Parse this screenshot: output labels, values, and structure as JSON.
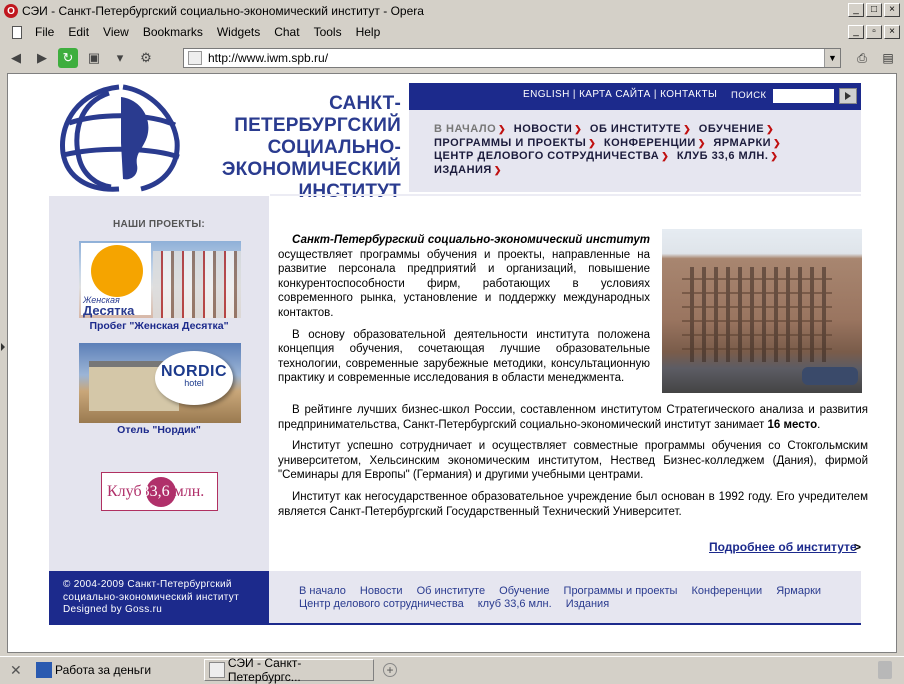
{
  "window": {
    "title": "СЭИ - Санкт-Петербургский социально-экономический институт - Opera"
  },
  "menu": [
    "File",
    "Edit",
    "View",
    "Bookmarks",
    "Widgets",
    "Chat",
    "Tools",
    "Help"
  ],
  "address": {
    "url": "http://www.iwm.spb.ru/"
  },
  "site": {
    "logo_lines": [
      "САНКТ-ПЕТЕРБУРГСКИЙ",
      "СОЦИАЛЬНО-",
      "ЭКОНОМИЧЕСКИЙ",
      "ИНСТИТУТ"
    ],
    "top_links": [
      "ENGLISH",
      "КАРТА САЙТА",
      "КОНТАКТЫ"
    ],
    "search_label": "ПОИСК",
    "nav": [
      "В НАЧАЛО",
      "НОВОСТИ",
      "ОБ ИНСТИТУТЕ",
      "ОБУЧЕНИЕ",
      "ПРОГРАММЫ И ПРОЕКТЫ",
      "КОНФЕРЕНЦИИ",
      "ЯРМАРКИ",
      "ЦЕНТР ДЕЛОВОГО СОТРУДНИЧЕСТВА",
      "КЛУБ 33,6 МЛН.",
      "ИЗДАНИЯ"
    ],
    "sidebar": {
      "title": "НАШИ ПРОЕКТЫ:",
      "project1_logo_small": "Женская",
      "project1_logo_big": "Десятка",
      "project1_caption": "Пробег \"Женская Десятка\"",
      "project2_logo": "NORDIC",
      "project2_logo_sub": "hotel",
      "project2_caption": "Отель \"Нордик\"",
      "club_a": "Клуб",
      "club_b": "33,6",
      "club_c": " млн."
    },
    "content": {
      "intro_bold": "Санкт-Петербургский социально-экономический институт",
      "intro_rest": " осуществляет программы обучения и проекты, направленные на развитие персонала предприятий и организаций, повышение конкурентоспособности фирм, работающих в условиях современного рынка, установление и поддержку международных контактов.",
      "p2": "В основу образовательной деятельности института положена концепция обучения, сочетающая лучшие образовательные технологии, современные зарубежные методики, консультационную практику и современные исследования в области менеджмента.",
      "p3_a": "В рейтинге лучших бизнес-школ России, составленном институтом Стратегического анализа и развития предпринимательства, Санкт-Петербургский социально-экономический институт занимает ",
      "p3_bold": "16 место",
      "p3_end": ".",
      "p4": "Институт успешно сотрудничает и осуществляет совместные программы обучения со Стокгольмским университетом, Хельсинским экономическим институтом, Нествед Бизнес-колледжем (Дания), фирмой \"Семинары для Европы\" (Германия) и другими учебными центрами.",
      "p5": "Институт как негосударственное образовательное учреждение был основан в 1992 году. Его учредителем является Санкт-Петербургский Государственный Технический Университет.",
      "more_link": "Подробнее об институте",
      "more_arrow": ">"
    },
    "footer": {
      "copyright": [
        "© 2004-2009 Санкт-Петербургский",
        "социально-экономический институт",
        "Designed by Goss.ru"
      ],
      "links_row1": [
        "В начало",
        "Новости",
        "Об институте",
        "Обучение",
        "Программы и проекты",
        "Конференции",
        "Ярмарки"
      ],
      "links_row2": [
        "Центр делового сотрудничества",
        "клуб 33,6 млн.",
        "Издания"
      ]
    }
  },
  "taskbar": {
    "task1": "Работа за деньги",
    "task2": "СЭИ - Санкт-Петербургс..."
  },
  "colors": {
    "brand_blue": "#1c2a8c",
    "nav_arrow": "#c01010",
    "club_magenta": "#b0306a"
  }
}
